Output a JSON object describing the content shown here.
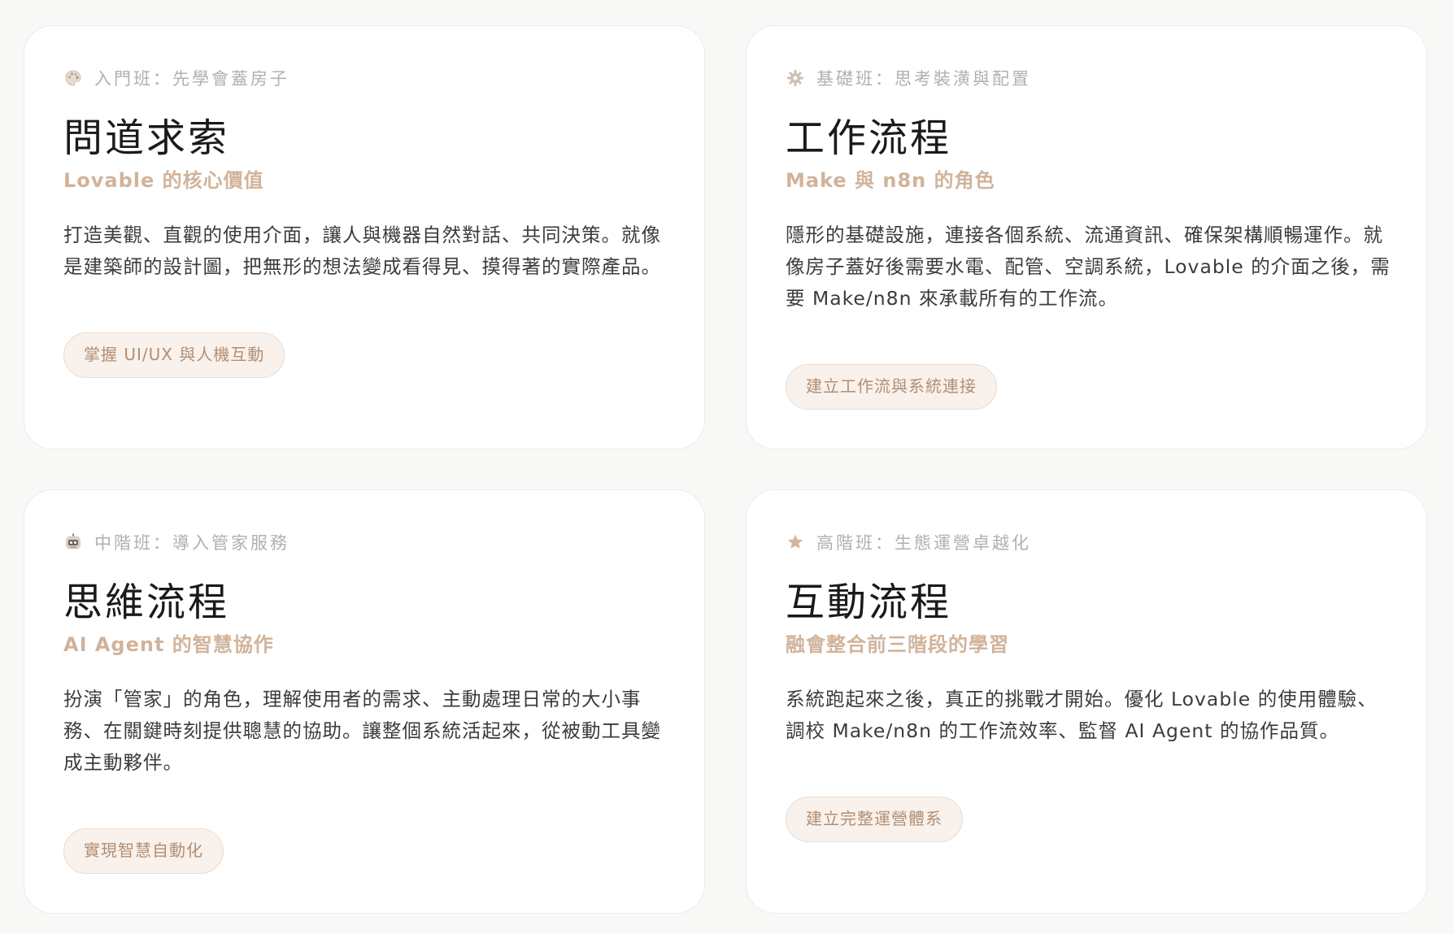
{
  "accent_color": "#d1b39a",
  "cards": [
    {
      "level_icon": "palette-icon",
      "level": "入門班：先學會蓋房子",
      "title": "問道求索",
      "subtitle": "Lovable 的核心價值",
      "description": "打造美觀、直觀的使用介面，讓人與機器自然對話、共同決策。就像是建築師的設計圖，把無形的想法變成看得見、摸得著的實際產品。",
      "tag": "掌握 UI/UX 與人機互動"
    },
    {
      "level_icon": "gear-icon",
      "level": "基礎班：思考裝潢與配置",
      "title": "工作流程",
      "subtitle": "Make 與 n8n 的角色",
      "description": "隱形的基礎設施，連接各個系統、流通資訊、確保架構順暢運作。就像房子蓋好後需要水電、配管、空調系統，Lovable 的介面之後，需要 Make/n8n 來承載所有的工作流。",
      "tag": "建立工作流與系統連接"
    },
    {
      "level_icon": "robot-icon",
      "level": "中階班：導入管家服務",
      "title": "思維流程",
      "subtitle": "AI Agent 的智慧協作",
      "description": "扮演「管家」的角色，理解使用者的需求、主動處理日常的大小事務、在關鍵時刻提供聰慧的協助。讓整個系統活起來，從被動工具變成主動夥伴。",
      "tag": "實現智慧自動化"
    },
    {
      "level_icon": "star-icon",
      "level": "高階班：生態運營卓越化",
      "title": "互動流程",
      "subtitle": "融會整合前三階段的學習",
      "description": "系統跑起來之後，真正的挑戰才開始。優化 Lovable 的使用體驗、調校 Make/n8n 的工作流效率、監督 AI Agent 的協作品質。",
      "tag": "建立完整運營體系"
    }
  ]
}
